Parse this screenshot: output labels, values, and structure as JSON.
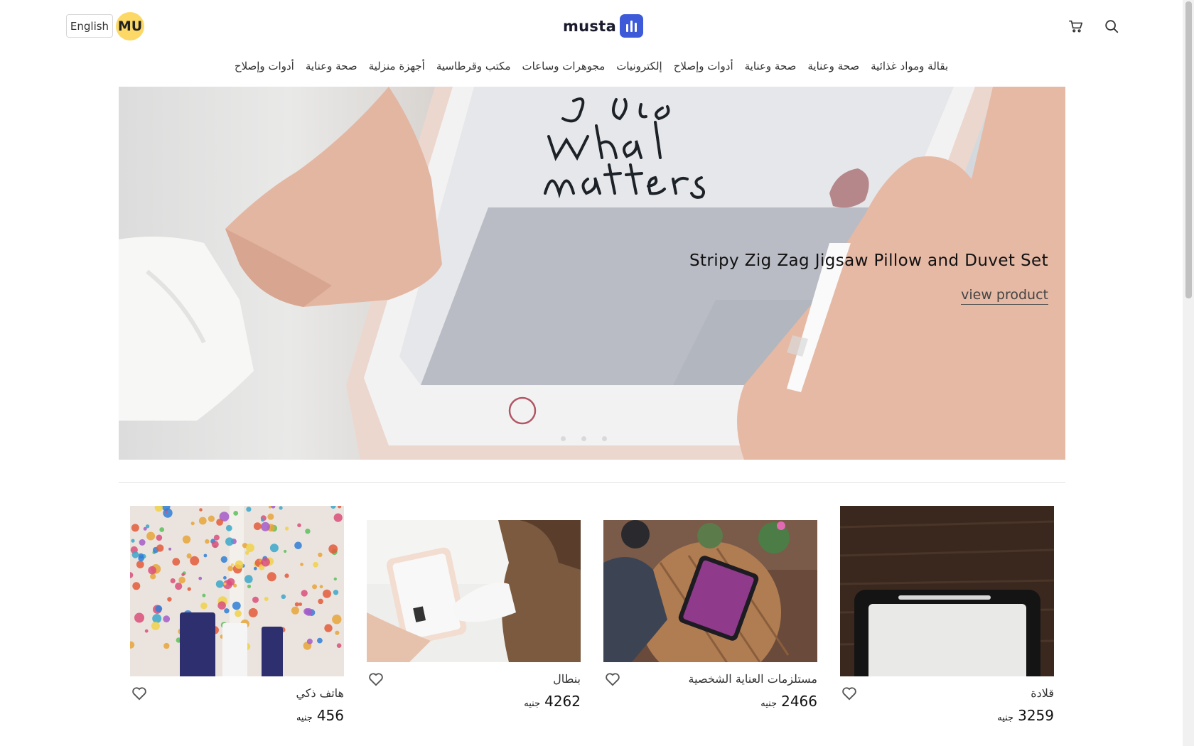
{
  "header": {
    "language_button": "English",
    "avatar_initials": "MU",
    "logo_text": "musta",
    "brand_color": "#3d5bd9",
    "avatar_color": "#fcd866",
    "icons": [
      "cart-icon",
      "search-icon"
    ]
  },
  "nav": {
    "items": [
      {
        "label": "بقالة ومواد غذائية"
      },
      {
        "label": "صحة وعناية"
      },
      {
        "label": "صحة وعناية"
      },
      {
        "label": "أدوات وإصلاح"
      },
      {
        "label": "إلكترونيات"
      },
      {
        "label": "مجوهرات وساعات"
      },
      {
        "label": "مكتب وقرطاسية"
      },
      {
        "label": "أجهزة منزلية"
      },
      {
        "label": "صحة وعناية"
      },
      {
        "label": "أدوات وإصلاح"
      }
    ]
  },
  "hero": {
    "title": "Stripy Zig Zag Jigsaw Pillow and Duvet Set",
    "link_label": "view product",
    "slide_count": 3,
    "image_text": "Jare what matters"
  },
  "products": [
    {
      "name": "قلادة",
      "price": "3259",
      "currency": "جنيه"
    },
    {
      "name": "مستلزمات العناية الشخصية",
      "price": "2466",
      "currency": "جنيه"
    },
    {
      "name": "بنطال",
      "price": "4262",
      "currency": "جنيه"
    },
    {
      "name": "هاتف ذكي",
      "price": "456",
      "currency": "جنيه"
    }
  ]
}
